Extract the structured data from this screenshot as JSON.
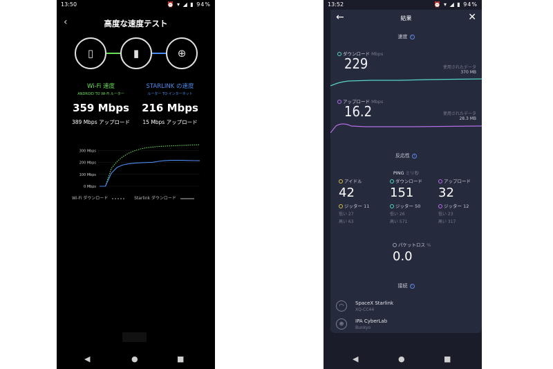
{
  "phone1": {
    "status": {
      "time": "13:50",
      "icons": "⏰ ▾ ◢ ▮",
      "battery": "94%"
    },
    "title": "高度な速度テスト",
    "wifi": {
      "label": "Wi-Fi 速度",
      "sub": "ANDROID TO Wi-Fi ルーター",
      "speed": "359 Mbps",
      "upload": "389 Mbps アップロード",
      "color": "#6be05a"
    },
    "starlink": {
      "label": "STARLINK の速度",
      "sub": "ルーター TO インターネット",
      "speed": "216 Mbps",
      "upload": "15 Mbps アップロード",
      "color": "#4d8cf0"
    },
    "chart_data": {
      "type": "line",
      "y_ticks": [
        "300 Mbps",
        "200 Mbps",
        "100 Mbps",
        "0 Mbps"
      ],
      "ylim": [
        0,
        350
      ],
      "legend": [
        "Wi-Fi ダウンロード",
        "Starlink ダウンロード"
      ],
      "series": [
        {
          "name": "Wi-Fi ダウンロード",
          "color": "#6be05a",
          "style": "dashed",
          "values": [
            0,
            0,
            150,
            210,
            250,
            280,
            300,
            315,
            325,
            330,
            335,
            338,
            340,
            342,
            344,
            346,
            348,
            350
          ]
        },
        {
          "name": "Starlink ダウンロード",
          "color": "#4d8cf0",
          "style": "solid",
          "values": [
            0,
            0,
            110,
            160,
            180,
            190,
            195,
            198,
            200,
            202,
            210,
            215,
            218,
            218,
            218,
            217,
            216,
            215
          ]
        }
      ]
    }
  },
  "phone2": {
    "status": {
      "time": "13:52",
      "icons": "⏰ ▾ ◢ ▮",
      "battery": "94%"
    },
    "header": {
      "title": "結果"
    },
    "speed_section": "速度",
    "download": {
      "label": "ダウンロード",
      "unit": "Mbps",
      "value": "229",
      "used_label": "使用されたデータ",
      "used": "370 MB",
      "color": "#56d6c9"
    },
    "upload": {
      "label": "アップロード",
      "unit": "Mbps",
      "value": "16.2",
      "used_label": "使用されたデータ",
      "used": "28.3 MB",
      "color": "#b46ee8"
    },
    "response_section": "反応性",
    "ping_title": "PING",
    "ping_unit": "ミリ秒",
    "ping": [
      {
        "label": "アイドル",
        "value": "42",
        "jitter": "ジッター 11",
        "low": "低い 27",
        "high": "高い 63",
        "color": "#d8c24a"
      },
      {
        "label": "ダウンロード",
        "value": "151",
        "jitter": "ジッター 50",
        "low": "低い 26",
        "high": "高い 571",
        "color": "#56d6c9"
      },
      {
        "label": "アップロード",
        "value": "32",
        "jitter": "ジッター 12",
        "low": "低い 23",
        "high": "高い 317",
        "color": "#b46ee8"
      }
    ],
    "packet_loss": {
      "label": "パケットロス",
      "unit": "%",
      "value": "0.0"
    },
    "connection_section": "接続",
    "connections": [
      {
        "name": "SpaceX Starlink",
        "sub": "XQ-CC44"
      },
      {
        "name": "IPA CyberLab",
        "sub": "Bunkyo"
      }
    ]
  },
  "nav": {
    "back": "◀",
    "home": "●",
    "recents": "■"
  }
}
